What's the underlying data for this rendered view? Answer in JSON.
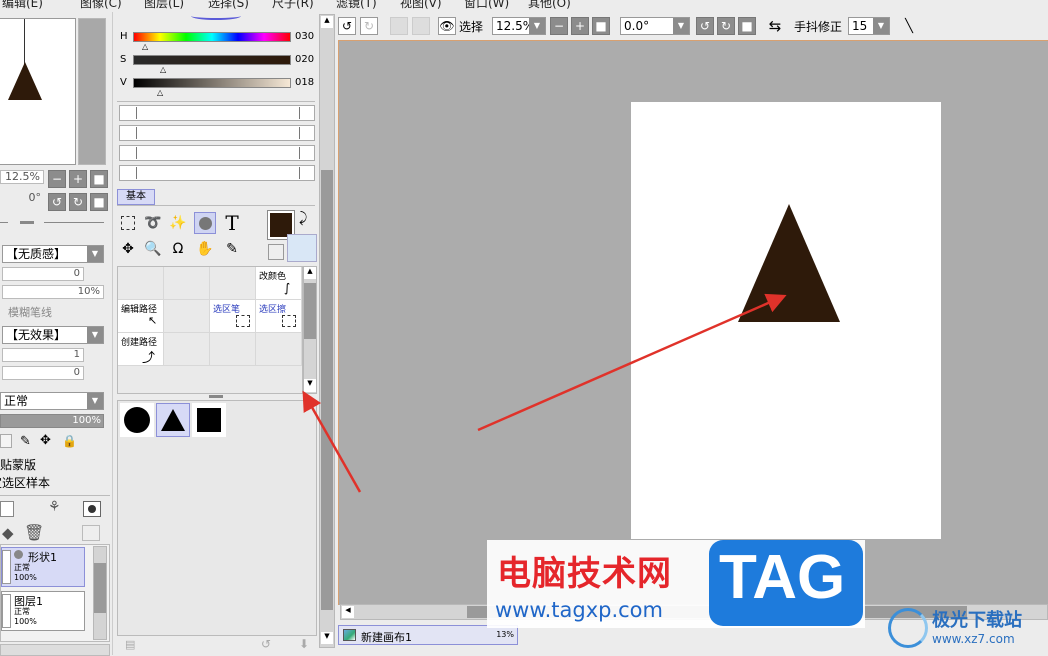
{
  "menu": [
    "编辑(E)",
    "图像(C)",
    "图层(L)",
    "选择(S)",
    "尺子(R)",
    "滤镜(T)",
    "视图(V)",
    "窗口(W)",
    "其他(O)"
  ],
  "navigator": {
    "zoom": "12.5%",
    "angle": "0°"
  },
  "color_panel": {
    "h_label": "H",
    "h_value": "030",
    "s_label": "S",
    "s_value": "020",
    "v_label": "V",
    "v_value": "018",
    "accent": "#2e1a0a"
  },
  "tool_tab": "基本",
  "brush": {
    "texture": "【无质感】",
    "texture_value": "0",
    "texture_pct": "10%",
    "blur_pen": "模糊笔线",
    "effect": "【无效果】",
    "effect_value": "1",
    "effect_value2": "0",
    "blend_mode": "正常",
    "opacity": "100%",
    "clipping": "剪贴蒙版",
    "selection_source": "指定选区样本"
  },
  "subtools": {
    "change_color": "改颜色",
    "edit_path": "编辑路径",
    "sel_pen": "选区笔",
    "sel_eraser": "选区擦",
    "create_path": "创建路径"
  },
  "layers": [
    {
      "name": "形状1",
      "mode": "正常",
      "opacity": "100%"
    },
    {
      "name": "图层1",
      "mode": "正常",
      "opacity": "100%"
    }
  ],
  "toolbar": {
    "select_label": "选择",
    "zoom": "12.5%",
    "angle": "0.0°",
    "stabilizer_label": "手抖修正",
    "stabilizer_value": "15"
  },
  "canvas_tab": {
    "name": "新建画布1",
    "zoom": "13%"
  },
  "watermark": {
    "title": "电脑技术网",
    "url": "www.tagxp.com",
    "tag": "TAG",
    "brand": "极光下载站",
    "brand_url": "www.xz7.com"
  },
  "colors": {
    "triangle": "#2e1a0a",
    "arrow": "#e0322a",
    "canvas_bg": "#acacac"
  }
}
